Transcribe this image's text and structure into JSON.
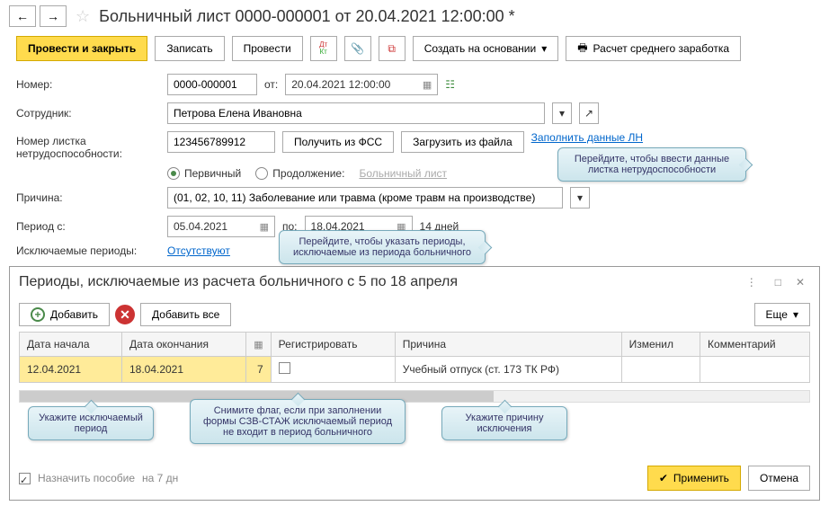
{
  "header": {
    "title": "Больничный лист 0000-000001 от 20.04.2021 12:00:00 *"
  },
  "toolbar": {
    "post_close": "Провести и закрыть",
    "write": "Записать",
    "post": "Провести",
    "create_based": "Создать на основании",
    "avg_calc": "Расчет среднего заработка"
  },
  "form": {
    "number_label": "Номер:",
    "number": "0000-000001",
    "from_label": "от:",
    "date": "20.04.2021 12:00:00",
    "employee_label": "Сотрудник:",
    "employee": "Петрова Елена Ивановна",
    "ln_number_label": "Номер листка нетрудоспособности:",
    "ln_number": "123456789912",
    "get_fss": "Получить из ФСС",
    "load_file": "Загрузить из файла",
    "fill_ln": "Заполнить данные ЛН",
    "radio_primary": "Первичный",
    "radio_continue": "Продолжение:",
    "sick_link": "Больничный лист",
    "reason_label": "Причина:",
    "reason": "(01, 02, 10, 11) Заболевание или травма (кроме травм на производстве)",
    "period_from_label": "Период с:",
    "period_from": "05.04.2021",
    "period_to_label": "по:",
    "period_to": "18.04.2021",
    "days": "14 дней",
    "excluded_label": "Исключаемые периоды:",
    "excluded_link": "Отсутствуют"
  },
  "tooltips": {
    "ln": "Перейдите, чтобы ввести данные листка нетрудоспособности",
    "excluded": "Перейдите, чтобы указать периоды, исключаемые из периода больничного",
    "period": "Укажите исключаемый период",
    "szv": "Снимите флаг, если при заполнении формы СЗВ-СТАЖ исключаемый период не входит в период больничного",
    "reason_t": "Укажите причину исключения"
  },
  "panel": {
    "title": "Периоды, исключаемые из расчета больничного с 5 по 18 апреля",
    "add": "Добавить",
    "add_all": "Добавить все",
    "more": "Еще",
    "columns": {
      "start": "Дата начала",
      "end": "Дата окончания",
      "cal": "",
      "register": "Регистрировать",
      "reason": "Причина",
      "changed": "Изменил",
      "comment": "Комментарий"
    },
    "row": {
      "start": "12.04.2021",
      "end": "18.04.2021",
      "days": "7",
      "reason": "Учебный отпуск (ст. 173 ТК РФ)"
    },
    "assign_label": "Назначить пособие",
    "days_suffix": "на 7 дн",
    "apply": "Применить",
    "cancel": "Отмена"
  }
}
